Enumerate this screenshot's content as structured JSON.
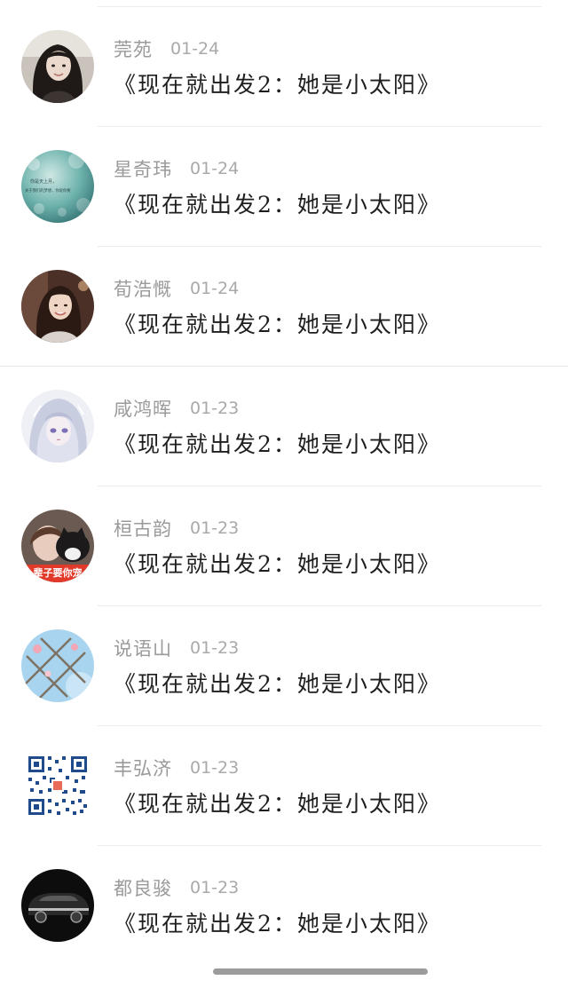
{
  "comments": [
    {
      "user": "莞苑",
      "date": "01-24",
      "text": "《现在就出发2：她是小太阳》",
      "avatar": "avatar-girl-long-hair"
    },
    {
      "user": "星奇玮",
      "date": "01-24",
      "text": "《现在就出发2：她是小太阳》",
      "avatar": "avatar-teal-bokeh-quote",
      "avatar_lines": [
        "你是天上月，",
        "关于我们的梦想，你说你要"
      ]
    },
    {
      "user": "荀浩慨",
      "date": "01-24",
      "text": "《现在就出发2：她是小太阳》",
      "avatar": "avatar-smiling-woman"
    },
    {
      "user": "咸鸿晖",
      "date": "01-23",
      "text": "《现在就出发2：她是小太阳》",
      "avatar": "avatar-anime-silver-hair"
    },
    {
      "user": "桓古韵",
      "date": "01-23",
      "text": "《现在就出发2：她是小太阳》",
      "avatar": "avatar-woman-with-cat",
      "avatar_caption": "辈子要你宠"
    },
    {
      "user": "说语山",
      "date": "01-23",
      "text": "《现在就出发2：她是小太阳》",
      "avatar": "avatar-sky-net-flowers"
    },
    {
      "user": "丰弘济",
      "date": "01-23",
      "text": "《现在就出发2：她是小太阳》",
      "avatar": "avatar-qr-code"
    },
    {
      "user": "都良骏",
      "date": "01-23",
      "text": "《现在就出发2：她是小太阳》",
      "avatar": "avatar-black-car"
    }
  ]
}
